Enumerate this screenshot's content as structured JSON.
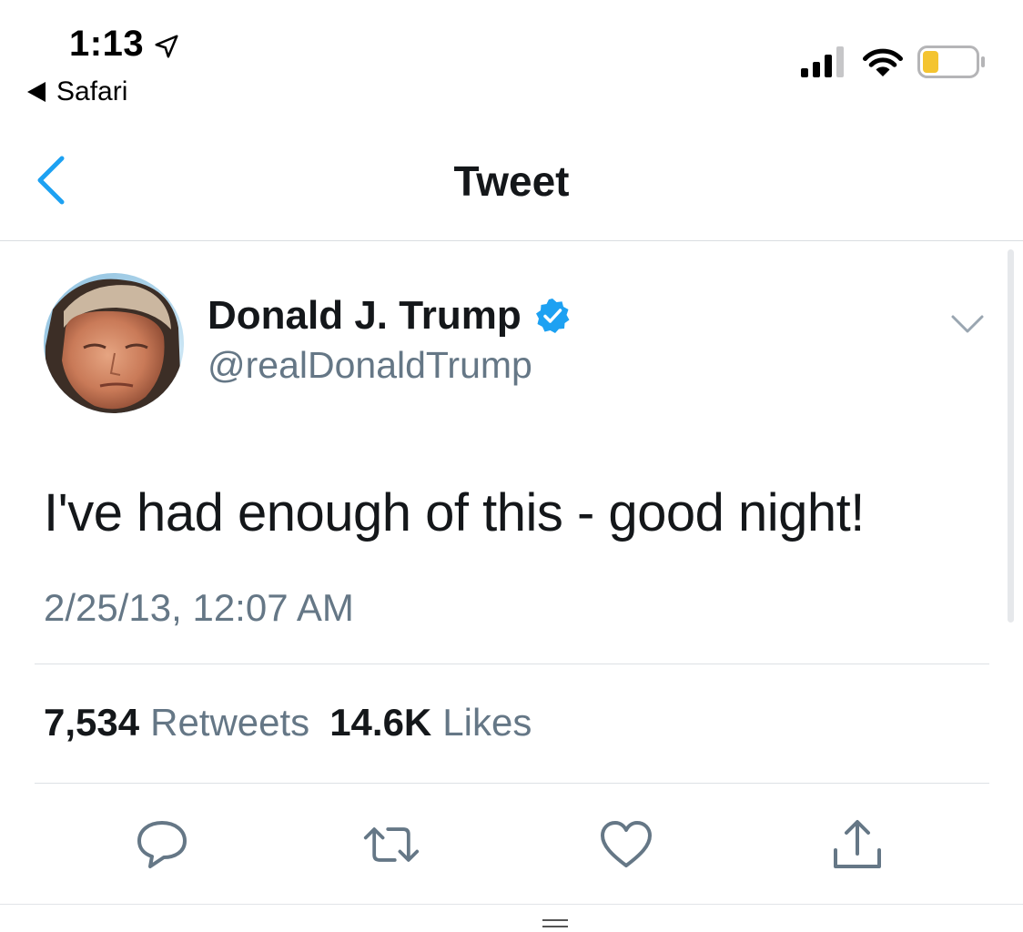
{
  "status_bar": {
    "time": "1:13",
    "back_app": "Safari"
  },
  "nav": {
    "title": "Tweet"
  },
  "tweet": {
    "author_name": "Donald J. Trump",
    "author_handle": "@realDonaldTrump",
    "text": "I've had enough of this - good night!",
    "timestamp": "2/25/13, 12:07 AM",
    "retweets_count": "7,534",
    "retweets_label": "Retweets",
    "likes_count": "14.6K",
    "likes_label": "Likes"
  },
  "icons": {
    "verified": "verified-badge-icon",
    "more": "chevron-down-icon",
    "reply": "reply-icon",
    "retweet": "retweet-icon",
    "like": "heart-icon",
    "share": "share-icon"
  },
  "colors": {
    "accent": "#1da1f2",
    "text_primary": "#14171a",
    "text_secondary": "#657786",
    "battery_fill": "#f4c430"
  },
  "battery_level": 0.3
}
